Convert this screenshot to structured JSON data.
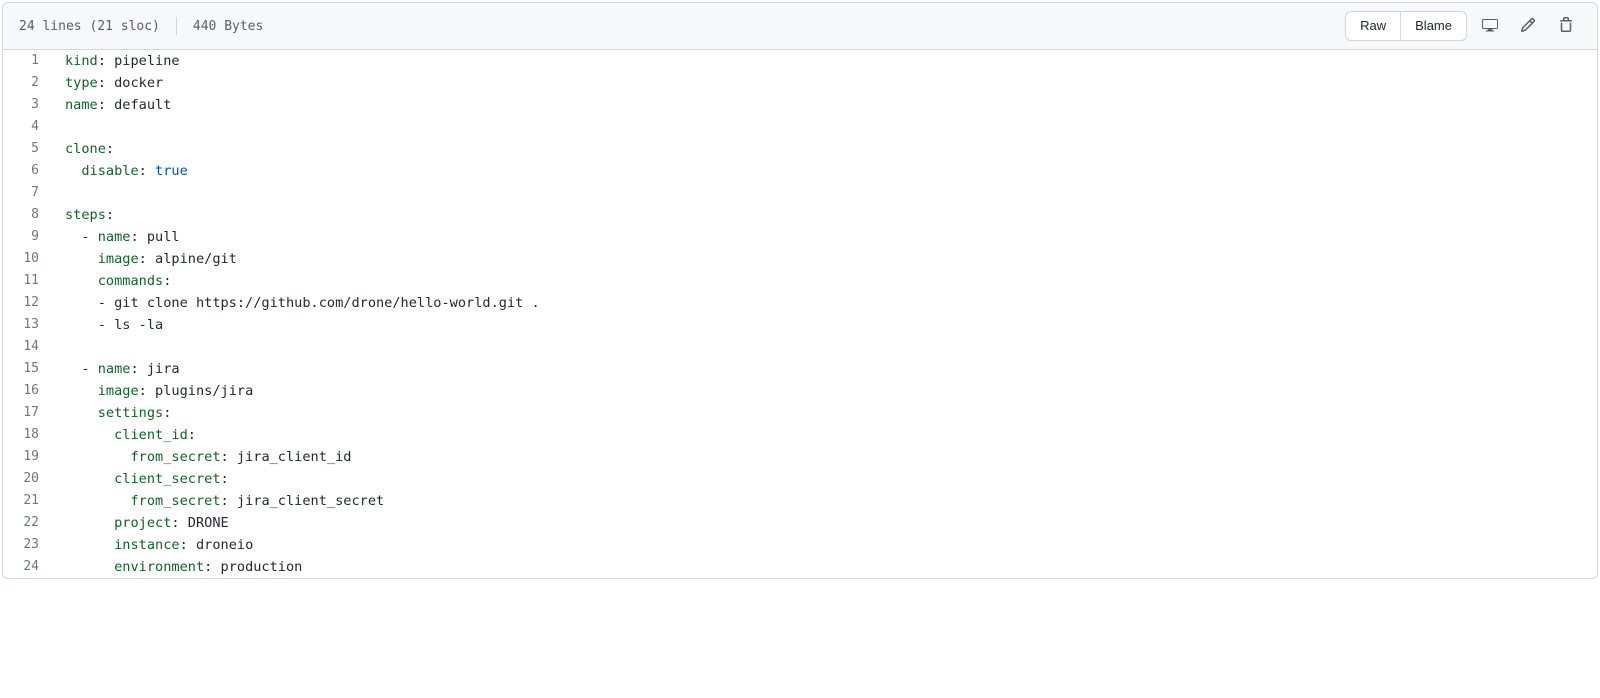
{
  "header": {
    "info_lines": "24 lines (21 sloc)",
    "info_bytes": "440 Bytes",
    "raw": "Raw",
    "blame": "Blame"
  },
  "code": {
    "lines": [
      {
        "n": 1,
        "tokens": [
          [
            "pl-ent",
            "kind"
          ],
          [
            "pl-s",
            ": "
          ],
          [
            "pl-s",
            "pipeline"
          ]
        ]
      },
      {
        "n": 2,
        "tokens": [
          [
            "pl-ent",
            "type"
          ],
          [
            "pl-s",
            ": "
          ],
          [
            "pl-s",
            "docker"
          ]
        ]
      },
      {
        "n": 3,
        "tokens": [
          [
            "pl-ent",
            "name"
          ],
          [
            "pl-s",
            ": "
          ],
          [
            "pl-s",
            "default"
          ]
        ]
      },
      {
        "n": 4,
        "tokens": []
      },
      {
        "n": 5,
        "tokens": [
          [
            "pl-ent",
            "clone"
          ],
          [
            "pl-s",
            ":"
          ]
        ]
      },
      {
        "n": 6,
        "tokens": [
          [
            "pl-s",
            "  "
          ],
          [
            "pl-ent",
            "disable"
          ],
          [
            "pl-s",
            ": "
          ],
          [
            "pl-c1",
            "true"
          ]
        ]
      },
      {
        "n": 7,
        "tokens": []
      },
      {
        "n": 8,
        "tokens": [
          [
            "pl-ent",
            "steps"
          ],
          [
            "pl-s",
            ":"
          ]
        ]
      },
      {
        "n": 9,
        "tokens": [
          [
            "pl-s",
            "  - "
          ],
          [
            "pl-ent",
            "name"
          ],
          [
            "pl-s",
            ": "
          ],
          [
            "pl-s",
            "pull"
          ]
        ]
      },
      {
        "n": 10,
        "tokens": [
          [
            "pl-s",
            "    "
          ],
          [
            "pl-ent",
            "image"
          ],
          [
            "pl-s",
            ": "
          ],
          [
            "pl-s",
            "alpine/git"
          ]
        ]
      },
      {
        "n": 11,
        "tokens": [
          [
            "pl-s",
            "    "
          ],
          [
            "pl-ent",
            "commands"
          ],
          [
            "pl-s",
            ":"
          ]
        ]
      },
      {
        "n": 12,
        "tokens": [
          [
            "pl-s",
            "    - "
          ],
          [
            "pl-s",
            "git clone https://github.com/drone/hello-world.git ."
          ]
        ]
      },
      {
        "n": 13,
        "tokens": [
          [
            "pl-s",
            "    - "
          ],
          [
            "pl-s",
            "ls -la"
          ]
        ]
      },
      {
        "n": 14,
        "tokens": []
      },
      {
        "n": 15,
        "tokens": [
          [
            "pl-s",
            "  - "
          ],
          [
            "pl-ent",
            "name"
          ],
          [
            "pl-s",
            ": "
          ],
          [
            "pl-s",
            "jira"
          ]
        ]
      },
      {
        "n": 16,
        "tokens": [
          [
            "pl-s",
            "    "
          ],
          [
            "pl-ent",
            "image"
          ],
          [
            "pl-s",
            ": "
          ],
          [
            "pl-s",
            "plugins/jira"
          ]
        ]
      },
      {
        "n": 17,
        "tokens": [
          [
            "pl-s",
            "    "
          ],
          [
            "pl-ent",
            "settings"
          ],
          [
            "pl-s",
            ":"
          ]
        ]
      },
      {
        "n": 18,
        "tokens": [
          [
            "pl-s",
            "      "
          ],
          [
            "pl-ent",
            "client_id"
          ],
          [
            "pl-s",
            ":"
          ]
        ]
      },
      {
        "n": 19,
        "tokens": [
          [
            "pl-s",
            "        "
          ],
          [
            "pl-ent",
            "from_secret"
          ],
          [
            "pl-s",
            ": "
          ],
          [
            "pl-s",
            "jira_client_id"
          ]
        ]
      },
      {
        "n": 20,
        "tokens": [
          [
            "pl-s",
            "      "
          ],
          [
            "pl-ent",
            "client_secret"
          ],
          [
            "pl-s",
            ":"
          ]
        ]
      },
      {
        "n": 21,
        "tokens": [
          [
            "pl-s",
            "        "
          ],
          [
            "pl-ent",
            "from_secret"
          ],
          [
            "pl-s",
            ": "
          ],
          [
            "pl-s",
            "jira_client_secret"
          ]
        ]
      },
      {
        "n": 22,
        "tokens": [
          [
            "pl-s",
            "      "
          ],
          [
            "pl-ent",
            "project"
          ],
          [
            "pl-s",
            ": "
          ],
          [
            "pl-s",
            "DRONE"
          ]
        ]
      },
      {
        "n": 23,
        "tokens": [
          [
            "pl-s",
            "      "
          ],
          [
            "pl-ent",
            "instance"
          ],
          [
            "pl-s",
            ": "
          ],
          [
            "pl-s",
            "droneio"
          ]
        ]
      },
      {
        "n": 24,
        "tokens": [
          [
            "pl-s",
            "      "
          ],
          [
            "pl-ent",
            "environment"
          ],
          [
            "pl-s",
            ": "
          ],
          [
            "pl-s",
            "production"
          ]
        ]
      }
    ]
  }
}
